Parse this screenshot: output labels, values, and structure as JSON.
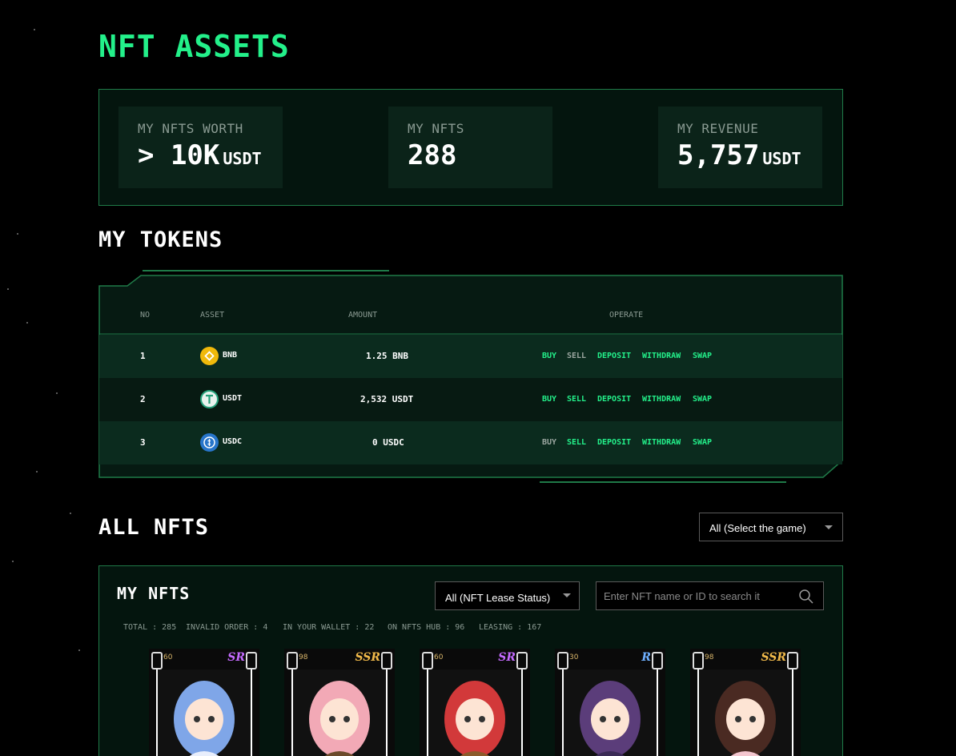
{
  "page": {
    "title": "NFT ASSETS"
  },
  "summary": {
    "worth": {
      "label": "MY NFTS WORTH",
      "value": "> 10K",
      "unit": "USDT"
    },
    "nfts": {
      "label": "MY NFTS",
      "value": "288"
    },
    "revenue": {
      "label": "MY REVENUE",
      "value": "5,757",
      "unit": "USDT"
    }
  },
  "tokens": {
    "title": "MY TOKENS",
    "headers": {
      "no": "NO",
      "asset": "ASSET",
      "amount": "AMOUNT",
      "operate": "OPERATE"
    },
    "rows": [
      {
        "no": "1",
        "asset": "BNB",
        "amount": "1.25 BNB",
        "coin_color": "#f0b90b",
        "sell_enabled": false,
        "ops": {
          "buy": "BUY",
          "sell": "SELL",
          "deposit": "DEPOSIT",
          "withdraw": "WITHDRAW",
          "swap": "SWAP"
        }
      },
      {
        "no": "2",
        "asset": "USDT",
        "amount": "2,532 USDT",
        "coin_color": "#26a17b",
        "sell_enabled": true,
        "ops": {
          "buy": "BUY",
          "sell": "SELL",
          "deposit": "DEPOSIT",
          "withdraw": "WITHDRAW",
          "swap": "SWAP"
        }
      },
      {
        "no": "3",
        "asset": "USDC",
        "amount": "0 USDC",
        "coin_color": "#2775ca",
        "buy_enabled": false,
        "ops": {
          "buy": "BUY",
          "sell": "SELL",
          "deposit": "DEPOSIT",
          "withdraw": "WITHDRAW",
          "swap": "SWAP"
        }
      }
    ]
  },
  "all_nfts": {
    "title": "ALL NFTS",
    "game_select": {
      "value": "All (Select the game)"
    }
  },
  "my_nfts": {
    "title": "MY NFTS",
    "lease_select": {
      "value": "All (NFT Lease Status)"
    },
    "search": {
      "placeholder": "Enter NFT name or ID to search it"
    },
    "stats": {
      "total": "TOTAL : 285",
      "invalid": "INVALID ORDER : 4",
      "wallet": "IN YOUR WALLET : 22",
      "hub": "ON NFTS HUB : 96",
      "leasing": "LEASING : 167"
    },
    "cards": [
      {
        "level": "60",
        "rarity": "SR",
        "rarity_color": "#c56bff",
        "hair": "#7fa6e8",
        "outfit": "#e8eefc"
      },
      {
        "level": "98",
        "rarity": "SSR",
        "rarity_color": "#f0b94a",
        "hair": "#f2a9b6",
        "outfit": "#6b4a2a"
      },
      {
        "level": "60",
        "rarity": "SR",
        "rarity_color": "#c56bff",
        "hair": "#d2393a",
        "outfit": "#8c5a2a"
      },
      {
        "level": "30",
        "rarity": "R",
        "rarity_color": "#6fb0ff",
        "hair": "#5b3d7a",
        "outfit": "#3a2a55"
      },
      {
        "level": "98",
        "rarity": "SSR",
        "rarity_color": "#f0b94a",
        "hair": "#4a2a22",
        "outfit": "#f4c6cf"
      }
    ]
  }
}
